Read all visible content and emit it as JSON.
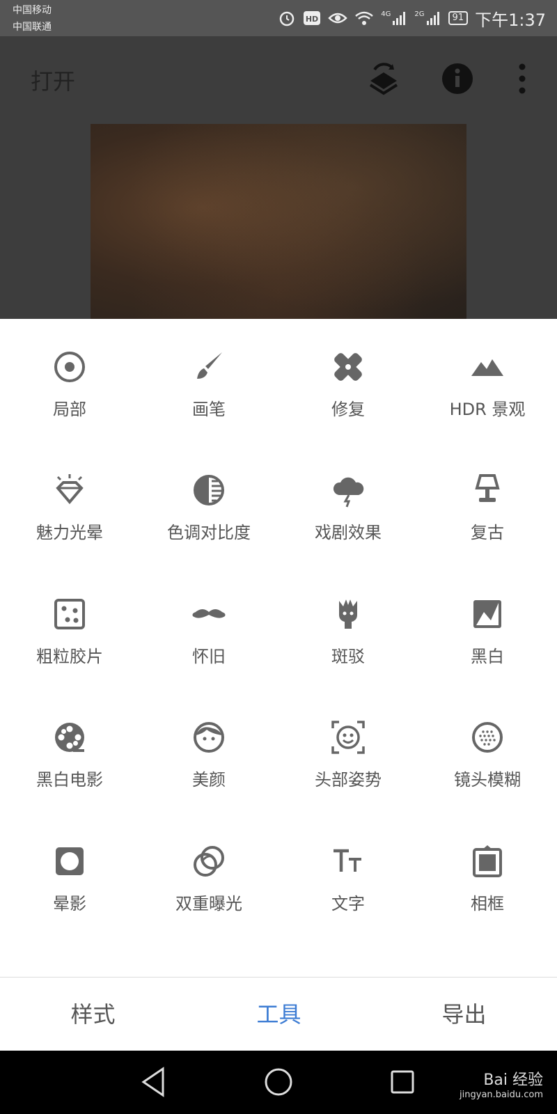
{
  "status": {
    "carrier1": "中国移动",
    "carrier2": "中国联通",
    "signal1": "4G",
    "signal2": "2G",
    "battery": "91",
    "time": "下午1:37"
  },
  "header": {
    "title": "打开"
  },
  "tools": [
    {
      "label": "局部",
      "icon": "target-icon"
    },
    {
      "label": "画笔",
      "icon": "brush-icon"
    },
    {
      "label": "修复",
      "icon": "bandage-icon"
    },
    {
      "label": "HDR 景观",
      "icon": "mountain-icon"
    },
    {
      "label": "魅力光晕",
      "icon": "diamond-icon"
    },
    {
      "label": "色调对比度",
      "icon": "contrast-icon"
    },
    {
      "label": "戏剧效果",
      "icon": "storm-cloud-icon"
    },
    {
      "label": "复古",
      "icon": "lamp-icon"
    },
    {
      "label": "粗粒胶片",
      "icon": "dice-icon"
    },
    {
      "label": "怀旧",
      "icon": "mustache-icon"
    },
    {
      "label": "斑驳",
      "icon": "guitar-icon"
    },
    {
      "label": "黑白",
      "icon": "bw-photo-icon"
    },
    {
      "label": "黑白电影",
      "icon": "film-reel-icon"
    },
    {
      "label": "美颜",
      "icon": "face-icon"
    },
    {
      "label": "头部姿势",
      "icon": "face-scan-icon"
    },
    {
      "label": "镜头模糊",
      "icon": "lens-blur-icon"
    },
    {
      "label": "晕影",
      "icon": "vignette-icon"
    },
    {
      "label": "双重曝光",
      "icon": "double-exposure-icon"
    },
    {
      "label": "文字",
      "icon": "text-icon"
    },
    {
      "label": "相框",
      "icon": "frame-icon"
    }
  ],
  "bottom_tabs": [
    "样式",
    "工具",
    "导出"
  ],
  "watermark": {
    "brand": "Bai 经验",
    "url": "jingyan.baidu.com"
  },
  "colors": {
    "accent": "#3b7bd3",
    "icon": "#666666",
    "label": "#555555"
  }
}
